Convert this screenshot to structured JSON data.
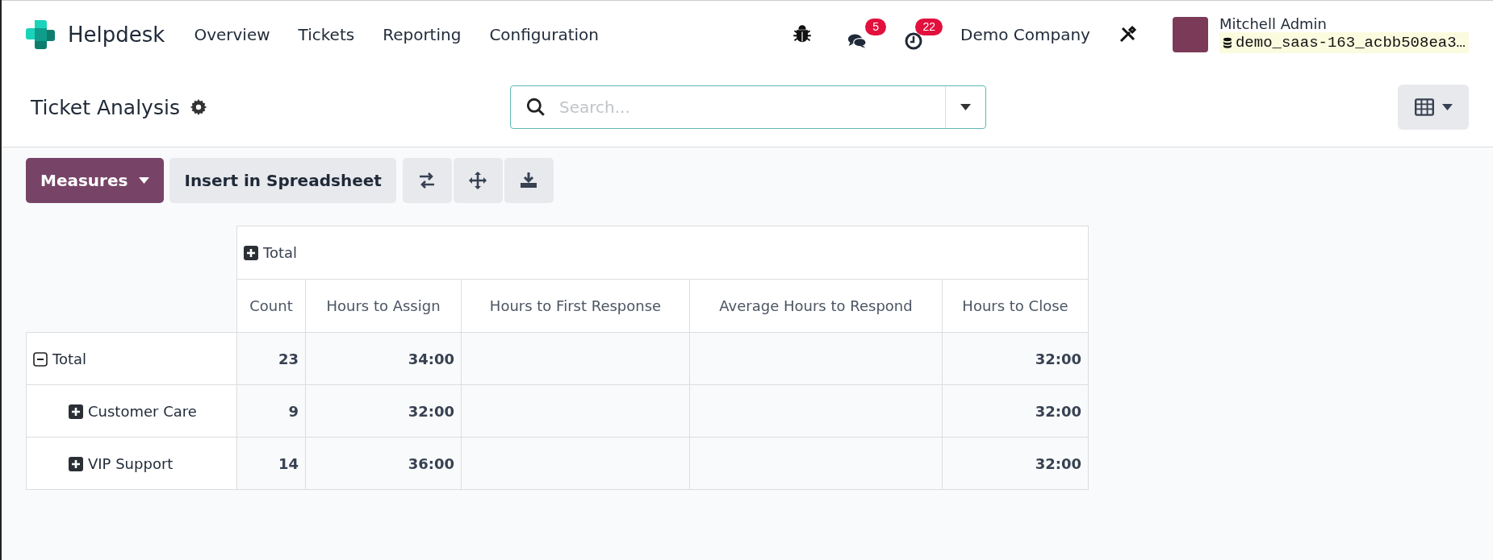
{
  "navbar": {
    "app_name": "Helpdesk",
    "menu": [
      "Overview",
      "Tickets",
      "Reporting",
      "Configuration"
    ],
    "messages_badge": "5",
    "activities_badge": "22",
    "company": "Demo Company",
    "user_name": "Mitchell Admin",
    "database": "demo_saas-163_acbb508ea3…"
  },
  "control_panel": {
    "title": "Ticket Analysis",
    "search": {
      "placeholder": "Search..."
    }
  },
  "toolbar": {
    "measures": "Measures",
    "insert": "Insert in Spreadsheet"
  },
  "pivot": {
    "column_group": {
      "label": "Total",
      "expanded": false
    },
    "columns": [
      "Count",
      "Hours to Assign",
      "Hours to First Response",
      "Average Hours to Respond",
      "Hours to Close"
    ],
    "rows": [
      {
        "label": "Total",
        "expanded": true,
        "cells": [
          "23",
          "34:00",
          "",
          "",
          "32:00"
        ],
        "children": [
          {
            "label": "Customer Care",
            "expanded": false,
            "cells": [
              "9",
              "32:00",
              "",
              "",
              "32:00"
            ]
          },
          {
            "label": "VIP Support",
            "expanded": false,
            "cells": [
              "14",
              "36:00",
              "",
              "",
              "32:00"
            ]
          }
        ]
      }
    ]
  }
}
